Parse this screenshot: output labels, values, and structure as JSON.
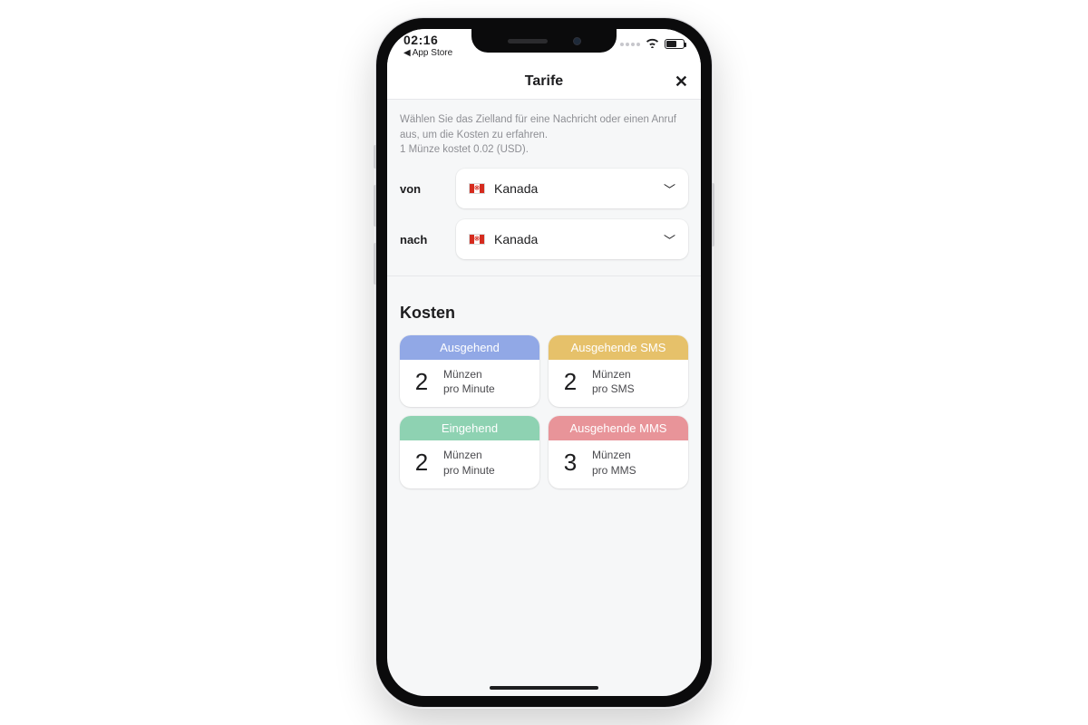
{
  "status": {
    "time": "02:16",
    "back_label": "App Store"
  },
  "nav": {
    "title": "Tarife",
    "close_glyph": "✕"
  },
  "help": {
    "line1": "Wählen Sie das Zielland für eine Nachricht oder einen Anruf aus, um die Kosten zu erfahren.",
    "line2": "1 Münze kostet 0.02 (USD)."
  },
  "selector": {
    "from_label": "von",
    "to_label": "nach",
    "from_value": "Kanada",
    "to_value": "Kanada",
    "flag_glyph": "❋"
  },
  "costs": {
    "title": "Kosten",
    "cards": [
      {
        "head": "Ausgehend",
        "value": "2",
        "unit_line1": "Münzen",
        "unit_line2": "pro Minute",
        "color": "blue"
      },
      {
        "head": "Ausgehende SMS",
        "value": "2",
        "unit_line1": "Münzen",
        "unit_line2": "pro SMS",
        "color": "yellow"
      },
      {
        "head": "Eingehend",
        "value": "2",
        "unit_line1": "Münzen",
        "unit_line2": "pro Minute",
        "color": "green"
      },
      {
        "head": "Ausgehende MMS",
        "value": "3",
        "unit_line1": "Münzen",
        "unit_line2": "pro MMS",
        "color": "red"
      }
    ]
  }
}
